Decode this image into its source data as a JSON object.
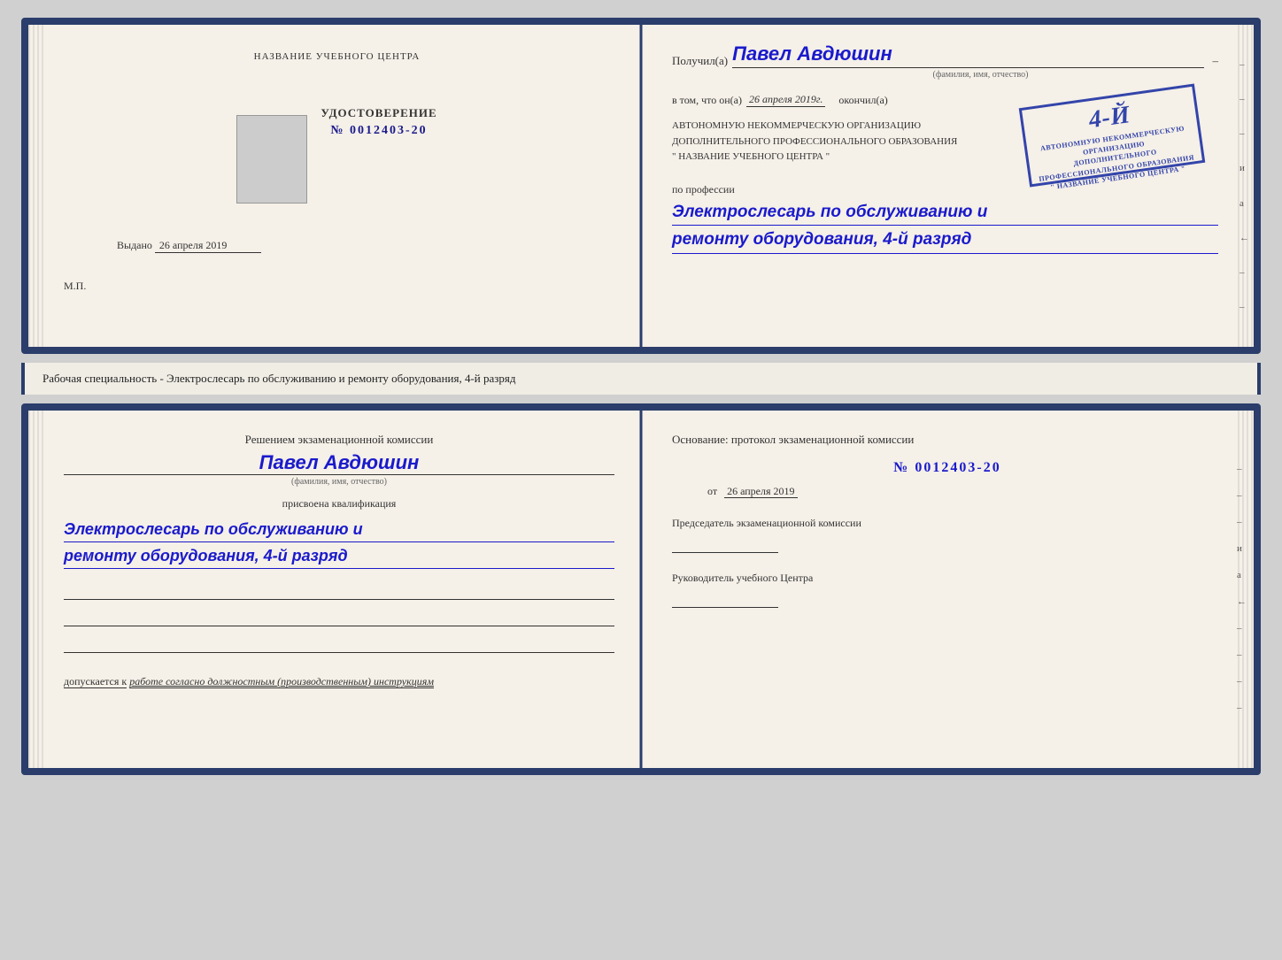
{
  "doc_top": {
    "left": {
      "org_title": "НАЗВАНИЕ УЧЕБНОГО ЦЕНТРА",
      "cert_label": "УДОСТОВЕРЕНИЕ",
      "cert_number_prefix": "№",
      "cert_number": "0012403-20",
      "issued_prefix": "Выдано",
      "issued_date": "26 апреля 2019",
      "mp_label": "М.П."
    },
    "right": {
      "received_prefix": "Получил(а)",
      "received_name": "Павел Авдюшин",
      "fio_label": "(фамилия, имя, отчество)",
      "vtom_prefix": "в том, что он(а)",
      "vtom_date": "26 апреля 2019г.",
      "okonchil": "окончил(а)",
      "avtonomnuyu_line1": "АВТОНОМНУЮ НЕКОММЕРЧЕСКУЮ ОРГАНИЗАЦИЮ",
      "avtonomnuyu_line2": "ДОПОЛНИТЕЛЬНОГО ПРОФЕССИОНАЛЬНОГО ОБРАЗОВАНИЯ",
      "center_name": "\" НАЗВАНИЕ УЧЕБНОГО ЦЕНТРА \"",
      "po_professii_label": "по профессии",
      "profession_line1": "Электрослесарь по обслуживанию и",
      "profession_line2": "ремонту оборудования, 4-й разряд",
      "stamp_number": "4-й",
      "stamp_line1": "АВТОНОМНУЮ НЕКОММЕРЧЕСКУЮ ОРГАНИЗАЦИЮ",
      "stamp_line2": "ДОПОЛНИТЕЛЬНОГО ПРОФЕССИОНАЛЬНОГО ОБРАЗОВАНИЯ",
      "stamp_line3": "\" НАЗВАНИЕ УЧЕБНОГО ЦЕНТРА \""
    }
  },
  "middle": {
    "description": "Рабочая специальность - Электрослесарь по обслуживанию и ремонту оборудования, 4-й разряд"
  },
  "doc_bottom": {
    "left": {
      "resheniem_label": "Решением экзаменационной комиссии",
      "person_name": "Павел Авдюшин",
      "fio_label": "(фамилия, имя, отчество)",
      "prisvoena_label": "присвоена квалификация",
      "qualification_line1": "Электрослесарь по обслуживанию и",
      "qualification_line2": "ремонту оборудования, 4-й разряд",
      "dopuskaetsya_prefix": "допускается к",
      "dopuskaetsya_value": "работе согласно должностным (производственным) инструкциям"
    },
    "right": {
      "osnovanie_label": "Основание: протокол экзаменационной комиссии",
      "protocol_prefix": "№",
      "protocol_number": "0012403-20",
      "ot_prefix": "от",
      "ot_date": "26 апреля 2019",
      "chairman_label": "Председатель экзаменационной комиссии",
      "rukovoditel_label": "Руководитель учебного Центра"
    }
  },
  "side_marks": [
    "–",
    "–",
    "–",
    "и",
    "a",
    "←",
    "–",
    "–",
    "–",
    "–"
  ]
}
